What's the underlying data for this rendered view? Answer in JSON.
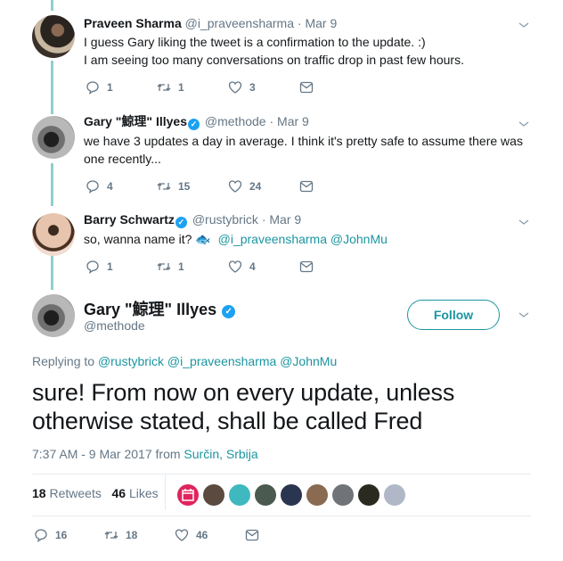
{
  "replies": [
    {
      "name": "Praveen Sharma",
      "verified": false,
      "handle": "@i_praveensharma",
      "separator": "·",
      "date": "Mar 9",
      "text_lines": [
        "I guess Gary liking the tweet is a confirmation to the update. :)",
        "I am seeing too many conversations on traffic drop in past few hours."
      ],
      "reply_count": "1",
      "retweet_count": "1",
      "like_count": "3"
    },
    {
      "name": "Gary \"鯨理\" Illyes",
      "verified": true,
      "handle": "@methode",
      "separator": "·",
      "date": "Mar 9",
      "text_lines": [
        "we have 3 updates a day in average. I think it's pretty safe to assume there was",
        "one recently..."
      ],
      "reply_count": "4",
      "retweet_count": "15",
      "like_count": "24"
    },
    {
      "name": "Barry Schwartz",
      "verified": true,
      "handle": "@rustybrick",
      "separator": "·",
      "date": "Mar 9",
      "text": "so, wanna name it?",
      "emoji": "🐟",
      "mentions": "@i_praveensharma @JohnMu",
      "reply_count": "1",
      "retweet_count": "1",
      "like_count": "4"
    }
  ],
  "main_tweet": {
    "name": "Gary \"鯨理\" Illyes",
    "handle": "@methode",
    "follow_label": "Follow",
    "replying_prefix": "Replying to",
    "replying_to": "@rustybrick @i_praveensharma @JohnMu",
    "text": "sure! From now on every update, unless otherwise stated, shall be called Fred",
    "timestamp": "7:37 AM - 9 Mar 2017 from",
    "location": "Surčin, Srbija",
    "retweets_count": "18",
    "retweets_label": "Retweets",
    "likes_count": "46",
    "likes_label": "Likes",
    "reply_count": "16",
    "retweet_count": "18",
    "like_count": "46"
  },
  "likers": [
    {
      "name": "calendar-account",
      "color": "#e0245e"
    },
    {
      "name": "liker-2",
      "color": "#5a4a40"
    },
    {
      "name": "liker-3",
      "color": "#3fb8c0"
    },
    {
      "name": "liker-4",
      "color": "#4a5a50"
    },
    {
      "name": "liker-5",
      "color": "#2a3550"
    },
    {
      "name": "liker-6",
      "color": "#8a6a50"
    },
    {
      "name": "liker-7",
      "color": "#707478"
    },
    {
      "name": "liker-8",
      "color": "#2a2a20"
    },
    {
      "name": "liker-9",
      "color": "#b0b8c8"
    }
  ],
  "colors": {
    "accent": "#1b95a0",
    "thread_line": "#8fcfcd",
    "verified": "#1da1f2",
    "muted": "#657786"
  }
}
